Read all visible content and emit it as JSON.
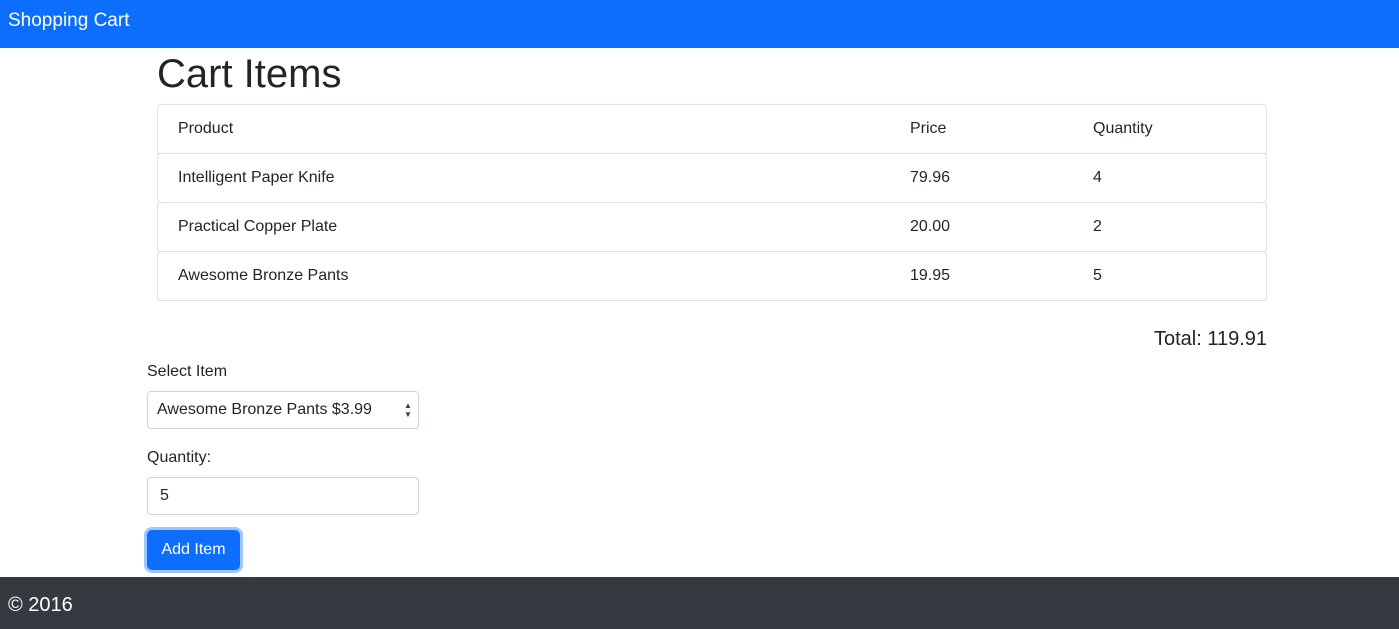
{
  "navbar": {
    "brand": "Shopping Cart"
  },
  "page": {
    "title": "Cart Items"
  },
  "cart": {
    "headers": {
      "product": "Product",
      "price": "Price",
      "quantity": "Quantity"
    },
    "items": [
      {
        "product": "Intelligent Paper Knife",
        "price": "79.96",
        "quantity": "4"
      },
      {
        "product": "Practical Copper Plate",
        "price": "20.00",
        "quantity": "2"
      },
      {
        "product": "Awesome Bronze Pants",
        "price": "19.95",
        "quantity": "5"
      }
    ],
    "total": "Total: 119.91"
  },
  "form": {
    "select_label": "Select Item",
    "selected_item": "Awesome Bronze Pants $3.99",
    "quantity_label": "Quantity:",
    "quantity_value": "5",
    "add_button": "Add Item"
  },
  "footer": {
    "text": "© 2016"
  },
  "colors": {
    "primary": "#0d6efd",
    "footer": "#343a40"
  }
}
